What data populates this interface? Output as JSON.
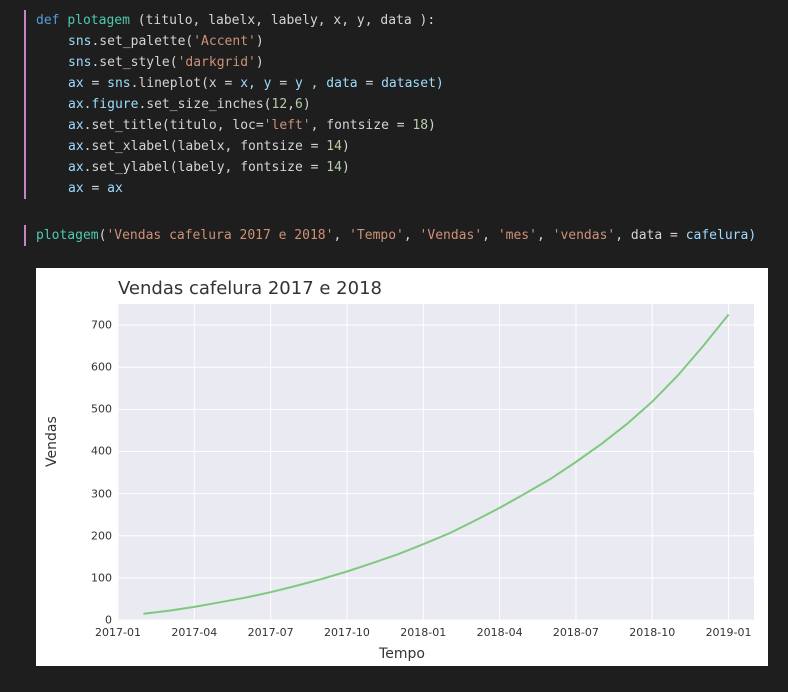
{
  "code1": {
    "l1": {
      "def": "def",
      "fn": "plotagem",
      "sig": " (titulo, labelx, labely, x, y, data ):"
    },
    "l2": {
      "a": "sns",
      "b": ".set_palette(",
      "s": "'Accent'",
      "c": ")"
    },
    "l3": {
      "a": "sns",
      "b": ".set_style(",
      "s": "'darkgrid'",
      "c": ")"
    },
    "l4": {
      "a": "ax ",
      "eq": "=",
      "b": " sns",
      "c": ".lineplot(x ",
      "eq2": "=",
      "d": " x, y ",
      "eq3": "=",
      "e": " y , data ",
      "eq4": "=",
      "f": " dataset)"
    },
    "l5": {
      "a": "ax.figure",
      "b": ".set_size_inches(",
      "n1": "12",
      "c": ",",
      "n2": "6",
      "d": ")"
    },
    "l6": {
      "a": "ax",
      "b": ".set_title(titulo, loc",
      "eq": "=",
      "s": "'left'",
      "c": ", fontsize ",
      "eq2": "=",
      "n": " 18",
      "d": ")"
    },
    "l7": {
      "a": "ax",
      "b": ".set_xlabel(labelx, fontsize ",
      "eq": "=",
      "n": " 14",
      "c": ")"
    },
    "l8": {
      "a": "ax",
      "b": ".set_ylabel(labely, fontsize ",
      "eq": "=",
      "n": " 14",
      "c": ")"
    },
    "l9": {
      "a": "ax ",
      "eq": "=",
      "b": " ax"
    }
  },
  "code2": {
    "fn": "plotagem",
    "open": "(",
    "s1": "'Vendas cafelura 2017 e 2018'",
    "c1": ", ",
    "s2": "'Tempo'",
    "c2": ", ",
    "s3": "'Vendas'",
    "c3": ", ",
    "s4": "'mes'",
    "c4": ", ",
    "s5": "'vendas'",
    "c5": ", data ",
    "eq": "=",
    "tail": " cafelura)"
  },
  "chart_data": {
    "type": "line",
    "title": "Vendas cafelura 2017 e 2018",
    "xlabel": "Tempo",
    "ylabel": "Vendas",
    "ylim": [
      0,
      750
    ],
    "yticks": [
      0,
      100,
      200,
      300,
      400,
      500,
      600,
      700
    ],
    "xticks": [
      "2017-01",
      "2017-04",
      "2017-07",
      "2017-10",
      "2018-01",
      "2018-04",
      "2018-07",
      "2018-10",
      "2019-01"
    ],
    "series": [
      {
        "name": "vendas",
        "x_month_index": [
          1,
          2,
          3,
          4,
          5,
          6,
          7,
          8,
          9,
          10,
          11,
          12,
          13,
          14,
          15,
          16,
          17,
          18,
          19,
          20,
          21,
          22,
          23,
          24
        ],
        "values": [
          15,
          22,
          31,
          42,
          53,
          66,
          81,
          97,
          115,
          135,
          156,
          180,
          205,
          235,
          266,
          300,
          335,
          375,
          418,
          465,
          518,
          580,
          650,
          725
        ]
      }
    ]
  }
}
